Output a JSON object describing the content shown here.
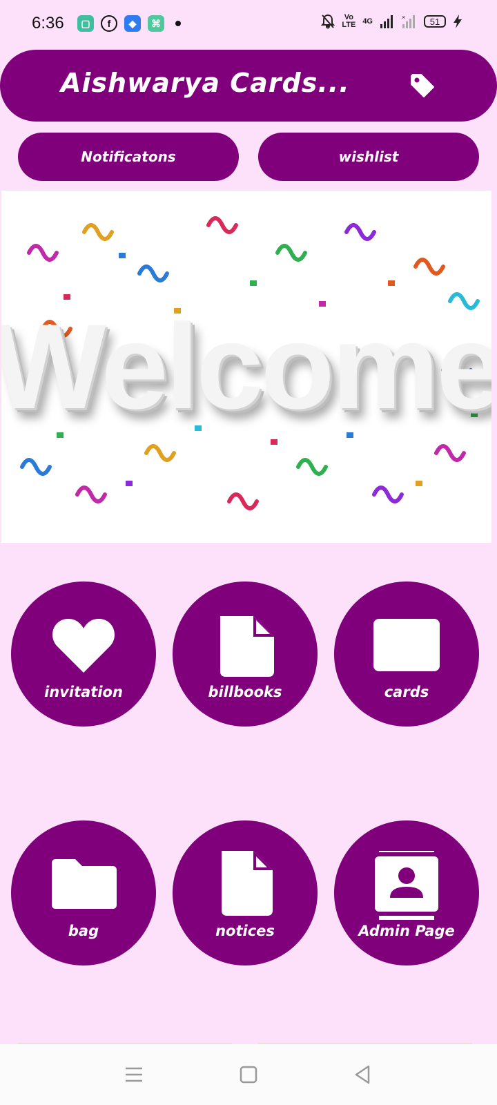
{
  "status_bar": {
    "time": "6:36",
    "network": "4G",
    "volte": "Vo\nLTE",
    "battery": "51"
  },
  "header": {
    "title": "Aishwarya Cards...",
    "icon": "tag-icon"
  },
  "buttons": {
    "notifications": "Notificatons",
    "wishlist": "wishlist"
  },
  "banner": {
    "text": "Welcome"
  },
  "tiles": [
    {
      "label": "invitation",
      "icon": "heart-icon"
    },
    {
      "label": "billbooks",
      "icon": "document-icon"
    },
    {
      "label": "cards",
      "icon": "card-icon"
    },
    {
      "label": "bag",
      "icon": "folder-icon"
    },
    {
      "label": "notices",
      "icon": "document-icon"
    },
    {
      "label": "Admin Page",
      "icon": "contact-book-icon"
    }
  ],
  "colors": {
    "background": "#fde0f9",
    "accent": "#80007c",
    "text_on_accent": "#ffffff"
  }
}
